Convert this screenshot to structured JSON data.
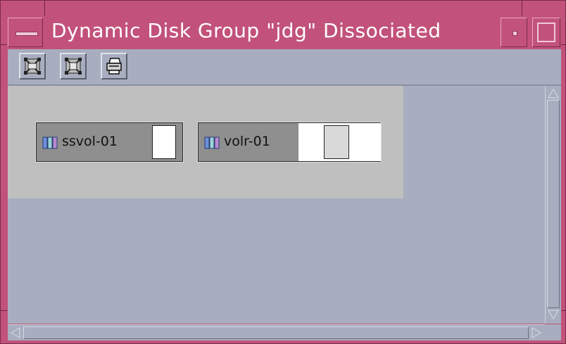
{
  "window": {
    "title": "Dynamic Disk Group \"jdg\" Dissociated",
    "colors": {
      "frame": "#c2527a",
      "background": "#a8aebf",
      "canvas": "#bfbfbf"
    }
  },
  "toolbar": {
    "buttons": [
      {
        "icon": "expand-disk-icon"
      },
      {
        "icon": "collapse-disk-icon"
      },
      {
        "icon": "printer-icon"
      }
    ]
  },
  "subdisks": [
    {
      "label": "ssvol-01",
      "icon": "subdisk-icon"
    },
    {
      "label": "volr-01",
      "icon": "subdisk-icon"
    }
  ]
}
